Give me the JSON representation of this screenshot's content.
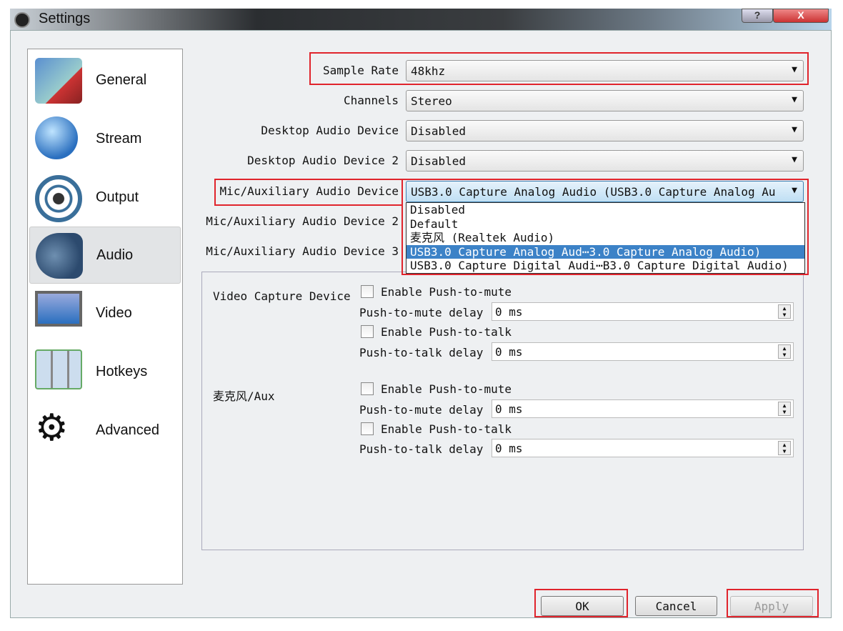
{
  "window": {
    "title": "Settings",
    "help": "?",
    "close": "X"
  },
  "sidebar": {
    "items": [
      {
        "label": "General"
      },
      {
        "label": "Stream"
      },
      {
        "label": "Output"
      },
      {
        "label": "Audio"
      },
      {
        "label": "Video"
      },
      {
        "label": "Hotkeys"
      },
      {
        "label": "Advanced"
      }
    ],
    "selected": "Audio"
  },
  "form": {
    "sample_rate": {
      "label": "Sample Rate",
      "value": "48khz"
    },
    "channels": {
      "label": "Channels",
      "value": "Stereo"
    },
    "desktop1": {
      "label": "Desktop Audio Device",
      "value": "Disabled"
    },
    "desktop2": {
      "label": "Desktop Audio Device 2",
      "value": "Disabled"
    },
    "mic1": {
      "label": "Mic/Auxiliary Audio Device",
      "value": "USB3.0 Capture Analog Audio (USB3.0 Capture Analog Au"
    },
    "mic2": {
      "label": "Mic/Auxiliary Audio Device 2"
    },
    "mic3": {
      "label": "Mic/Auxiliary Audio Device 3"
    }
  },
  "dropdown": {
    "options": [
      "Disabled",
      "Default",
      "麦克风 (Realtek Audio)",
      "USB3.0 Capture Analog Aud⋯3.0 Capture Analog Audio)",
      "USB3.0 Capture Digital Audi⋯B3.0 Capture Digital Audio)"
    ],
    "highlighted": 3
  },
  "hotkeys": [
    {
      "source": "Video Capture Device",
      "push_to_mute": "Enable Push-to-mute",
      "mute_delay_label": "Push-to-mute delay",
      "mute_delay": "0 ms",
      "push_to_talk": "Enable Push-to-talk",
      "talk_delay_label": "Push-to-talk delay",
      "talk_delay": "0 ms"
    },
    {
      "source": "麦克风/Aux",
      "push_to_mute": "Enable Push-to-mute",
      "mute_delay_label": "Push-to-mute delay",
      "mute_delay": "0 ms",
      "push_to_talk": "Enable Push-to-talk",
      "talk_delay_label": "Push-to-talk delay",
      "talk_delay": "0 ms"
    }
  ],
  "buttons": {
    "ok": "OK",
    "cancel": "Cancel",
    "apply": "Apply"
  },
  "colors": {
    "highlight": "#3c82c7",
    "annotation": "#e0242c"
  }
}
